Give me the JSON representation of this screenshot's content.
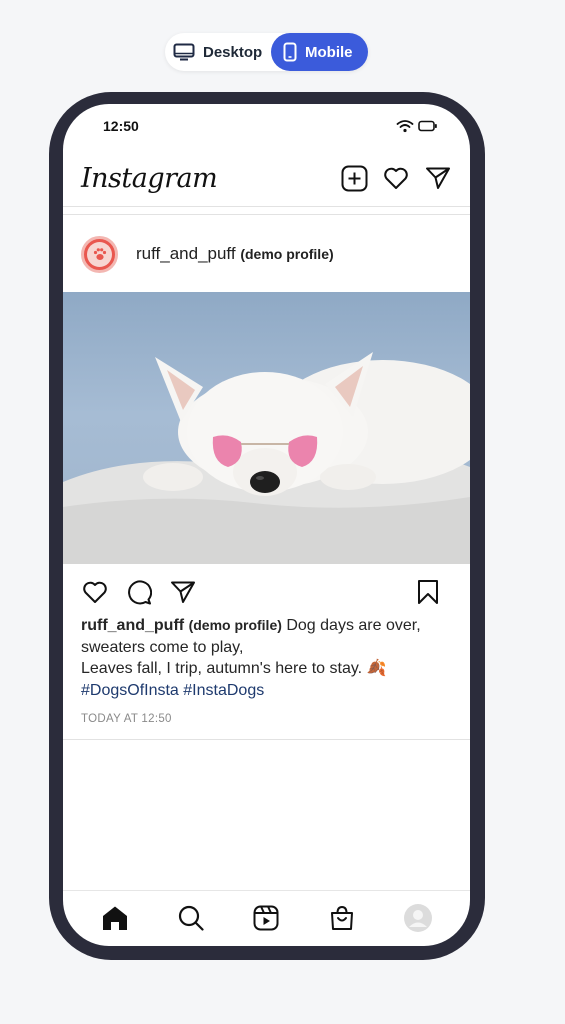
{
  "view_toggle": {
    "desktop_label": "Desktop",
    "mobile_label": "Mobile",
    "selected": "Mobile"
  },
  "status_bar": {
    "time": "12:50"
  },
  "app": {
    "logo": "Instagram"
  },
  "header_icons": [
    "new-post-icon",
    "heart-icon",
    "send-icon"
  ],
  "post": {
    "username": "ruff_and_puff",
    "demo_label": "(demo profile)",
    "caption_line1": " Dog days are over, sweaters come to play,",
    "caption_line2": "Leaves fall, I trip, autumn's here to stay. 🍂",
    "hashtags": [
      "#DogsOfInsta",
      "#InstaDogs"
    ],
    "timestamp": "TODAY AT 12:50"
  },
  "bottom_nav": [
    "home-icon",
    "search-icon",
    "reels-icon",
    "shop-icon",
    "profile-avatar"
  ],
  "colors": {
    "accent": "#3b5bdb",
    "phone_frame": "#2b2c3b",
    "hashtag": "#1e3a6e",
    "avatar": "#e9574f"
  }
}
